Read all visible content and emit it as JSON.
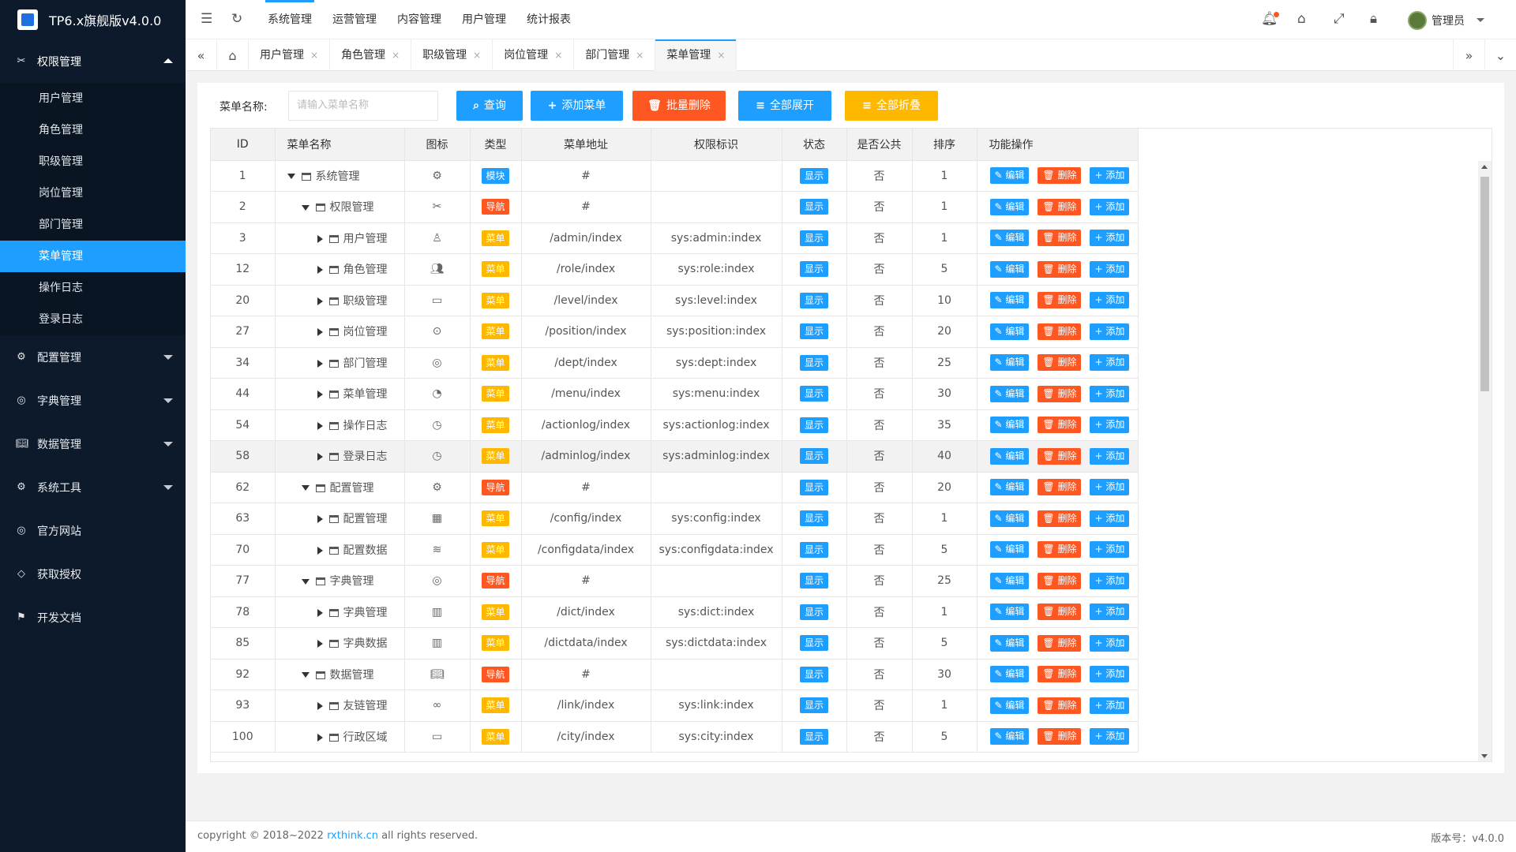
{
  "app": {
    "title": "TP6.x旗舰版v4.0.0"
  },
  "sidebar": {
    "groups": [
      {
        "label": "权限管理",
        "icon": "permission-icon",
        "expanded": true,
        "items": [
          "用户管理",
          "角色管理",
          "职级管理",
          "岗位管理",
          "部门管理",
          "菜单管理",
          "操作日志",
          "登录日志"
        ],
        "active": "菜单管理"
      },
      {
        "label": "配置管理",
        "icon": "gear-icon"
      },
      {
        "label": "字典管理",
        "icon": "globe-icon"
      },
      {
        "label": "数据管理",
        "icon": "book-icon"
      },
      {
        "label": "系统工具",
        "icon": "gear-icon"
      },
      {
        "label": "官方网站",
        "icon": "globe-icon"
      },
      {
        "label": "获取授权",
        "icon": "diamond-icon"
      },
      {
        "label": "开发文档",
        "icon": "flag-icon"
      }
    ]
  },
  "header": {
    "nav": [
      "系统管理",
      "运营管理",
      "内容管理",
      "用户管理",
      "统计报表"
    ],
    "active_nav": "系统管理",
    "user": "管理员",
    "icons": [
      "menu-fold-icon",
      "refresh-icon",
      "bell-icon",
      "tag-icon",
      "fullscreen-icon",
      "lock-icon"
    ]
  },
  "tabs": {
    "items": [
      "用户管理",
      "角色管理",
      "职级管理",
      "岗位管理",
      "部门管理",
      "菜单管理"
    ],
    "active": "菜单管理",
    "close_glyph": "×"
  },
  "toolbar": {
    "search_label": "菜单名称:",
    "search_placeholder": "请输入菜单名称",
    "buttons": [
      {
        "label": "查询",
        "icon": "search-icon",
        "color": "#1e9fff"
      },
      {
        "label": "添加菜单",
        "icon": "plus-icon",
        "color": "#1e9fff"
      },
      {
        "label": "批量删除",
        "icon": "trash-icon",
        "color": "#ff5722"
      },
      {
        "label": "全部展开",
        "icon": "expand-icon",
        "color": "#1e9fff"
      },
      {
        "label": "全部折叠",
        "icon": "collapse-icon",
        "color": "#ffb800"
      }
    ]
  },
  "table": {
    "columns": [
      "ID",
      "菜单名称",
      "图标",
      "类型",
      "菜单地址",
      "权限标识",
      "状态",
      "是否公共",
      "排序",
      "功能操作"
    ],
    "ops": {
      "edit": "编辑",
      "del": "删除",
      "add": "添加"
    },
    "rows": [
      {
        "id": "1",
        "name": "系统管理",
        "level": 0,
        "expanded": true,
        "icon": "gear-icon",
        "type": "模块",
        "url": "#",
        "perm": "",
        "status": "显示",
        "public": "否",
        "sort": "1"
      },
      {
        "id": "2",
        "name": "权限管理",
        "level": 1,
        "expanded": true,
        "icon": "permission-icon",
        "type": "导航",
        "url": "#",
        "perm": "",
        "status": "显示",
        "public": "否",
        "sort": "1"
      },
      {
        "id": "3",
        "name": "用户管理",
        "level": 2,
        "expanded": false,
        "icon": "user-icon",
        "type": "菜单",
        "url": "/admin/index",
        "perm": "sys:admin:index",
        "status": "显示",
        "public": "否",
        "sort": "1"
      },
      {
        "id": "12",
        "name": "角色管理",
        "level": 2,
        "expanded": false,
        "icon": "users-icon",
        "type": "菜单",
        "url": "/role/index",
        "perm": "sys:role:index",
        "status": "显示",
        "public": "否",
        "sort": "5"
      },
      {
        "id": "20",
        "name": "职级管理",
        "level": 2,
        "expanded": false,
        "icon": "window-icon",
        "type": "菜单",
        "url": "/level/index",
        "perm": "sys:level:index",
        "status": "显示",
        "public": "否",
        "sort": "10"
      },
      {
        "id": "27",
        "name": "岗位管理",
        "level": 2,
        "expanded": false,
        "icon": "code-icon",
        "type": "菜单",
        "url": "/position/index",
        "perm": "sys:position:index",
        "status": "显示",
        "public": "否",
        "sort": "20"
      },
      {
        "id": "34",
        "name": "部门管理",
        "level": 2,
        "expanded": false,
        "icon": "globe-icon",
        "type": "菜单",
        "url": "/dept/index",
        "perm": "sys:dept:index",
        "status": "显示",
        "public": "否",
        "sort": "25"
      },
      {
        "id": "44",
        "name": "菜单管理",
        "level": 2,
        "expanded": false,
        "icon": "gamepad-icon",
        "type": "菜单",
        "url": "/menu/index",
        "perm": "sys:menu:index",
        "status": "显示",
        "public": "否",
        "sort": "30"
      },
      {
        "id": "54",
        "name": "操作日志",
        "level": 2,
        "expanded": false,
        "icon": "clock-icon",
        "type": "菜单",
        "url": "/actionlog/index",
        "perm": "sys:actionlog:index",
        "status": "显示",
        "public": "否",
        "sort": "35"
      },
      {
        "id": "58",
        "name": "登录日志",
        "level": 2,
        "expanded": false,
        "icon": "clock-icon",
        "type": "菜单",
        "url": "/adminlog/index",
        "perm": "sys:adminlog:index",
        "status": "显示",
        "public": "否",
        "sort": "40",
        "hover": true
      },
      {
        "id": "62",
        "name": "配置管理",
        "level": 1,
        "expanded": true,
        "icon": "gear-icon",
        "type": "导航",
        "url": "#",
        "perm": "",
        "status": "显示",
        "public": "否",
        "sort": "20"
      },
      {
        "id": "63",
        "name": "配置管理",
        "level": 2,
        "expanded": false,
        "icon": "apps-icon",
        "type": "菜单",
        "url": "/config/index",
        "perm": "sys:config:index",
        "status": "显示",
        "public": "否",
        "sort": "1"
      },
      {
        "id": "70",
        "name": "配置数据",
        "level": 2,
        "expanded": false,
        "icon": "layers-icon",
        "type": "菜单",
        "url": "/configdata/index",
        "perm": "sys:configdata:index",
        "status": "显示",
        "public": "否",
        "sort": "5"
      },
      {
        "id": "77",
        "name": "字典管理",
        "level": 1,
        "expanded": true,
        "icon": "globe-icon",
        "type": "导航",
        "url": "#",
        "perm": "",
        "status": "显示",
        "public": "否",
        "sort": "25"
      },
      {
        "id": "78",
        "name": "字典管理",
        "level": 2,
        "expanded": false,
        "icon": "dict-icon",
        "type": "菜单",
        "url": "/dict/index",
        "perm": "sys:dict:index",
        "status": "显示",
        "public": "否",
        "sort": "1"
      },
      {
        "id": "85",
        "name": "字典数据",
        "level": 2,
        "expanded": false,
        "icon": "dict-icon",
        "type": "菜单",
        "url": "/dictdata/index",
        "perm": "sys:dictdata:index",
        "status": "显示",
        "public": "否",
        "sort": "5"
      },
      {
        "id": "92",
        "name": "数据管理",
        "level": 1,
        "expanded": true,
        "icon": "book-icon",
        "type": "导航",
        "url": "#",
        "perm": "",
        "status": "显示",
        "public": "否",
        "sort": "30"
      },
      {
        "id": "93",
        "name": "友链管理",
        "level": 2,
        "expanded": false,
        "icon": "link-icon",
        "type": "菜单",
        "url": "/link/index",
        "perm": "sys:link:index",
        "status": "显示",
        "public": "否",
        "sort": "1"
      },
      {
        "id": "100",
        "name": "行政区域",
        "level": 2,
        "expanded": false,
        "icon": "window-icon",
        "type": "菜单",
        "url": "/city/index",
        "perm": "sys:city:index",
        "status": "显示",
        "public": "否",
        "sort": "5"
      }
    ]
  },
  "footer": {
    "copyright_prefix": "copyright © 2018~2022 ",
    "link": "rxthink.cn",
    "copyright_suffix": " all rights reserved.",
    "version": "版本号：v4.0.0"
  }
}
